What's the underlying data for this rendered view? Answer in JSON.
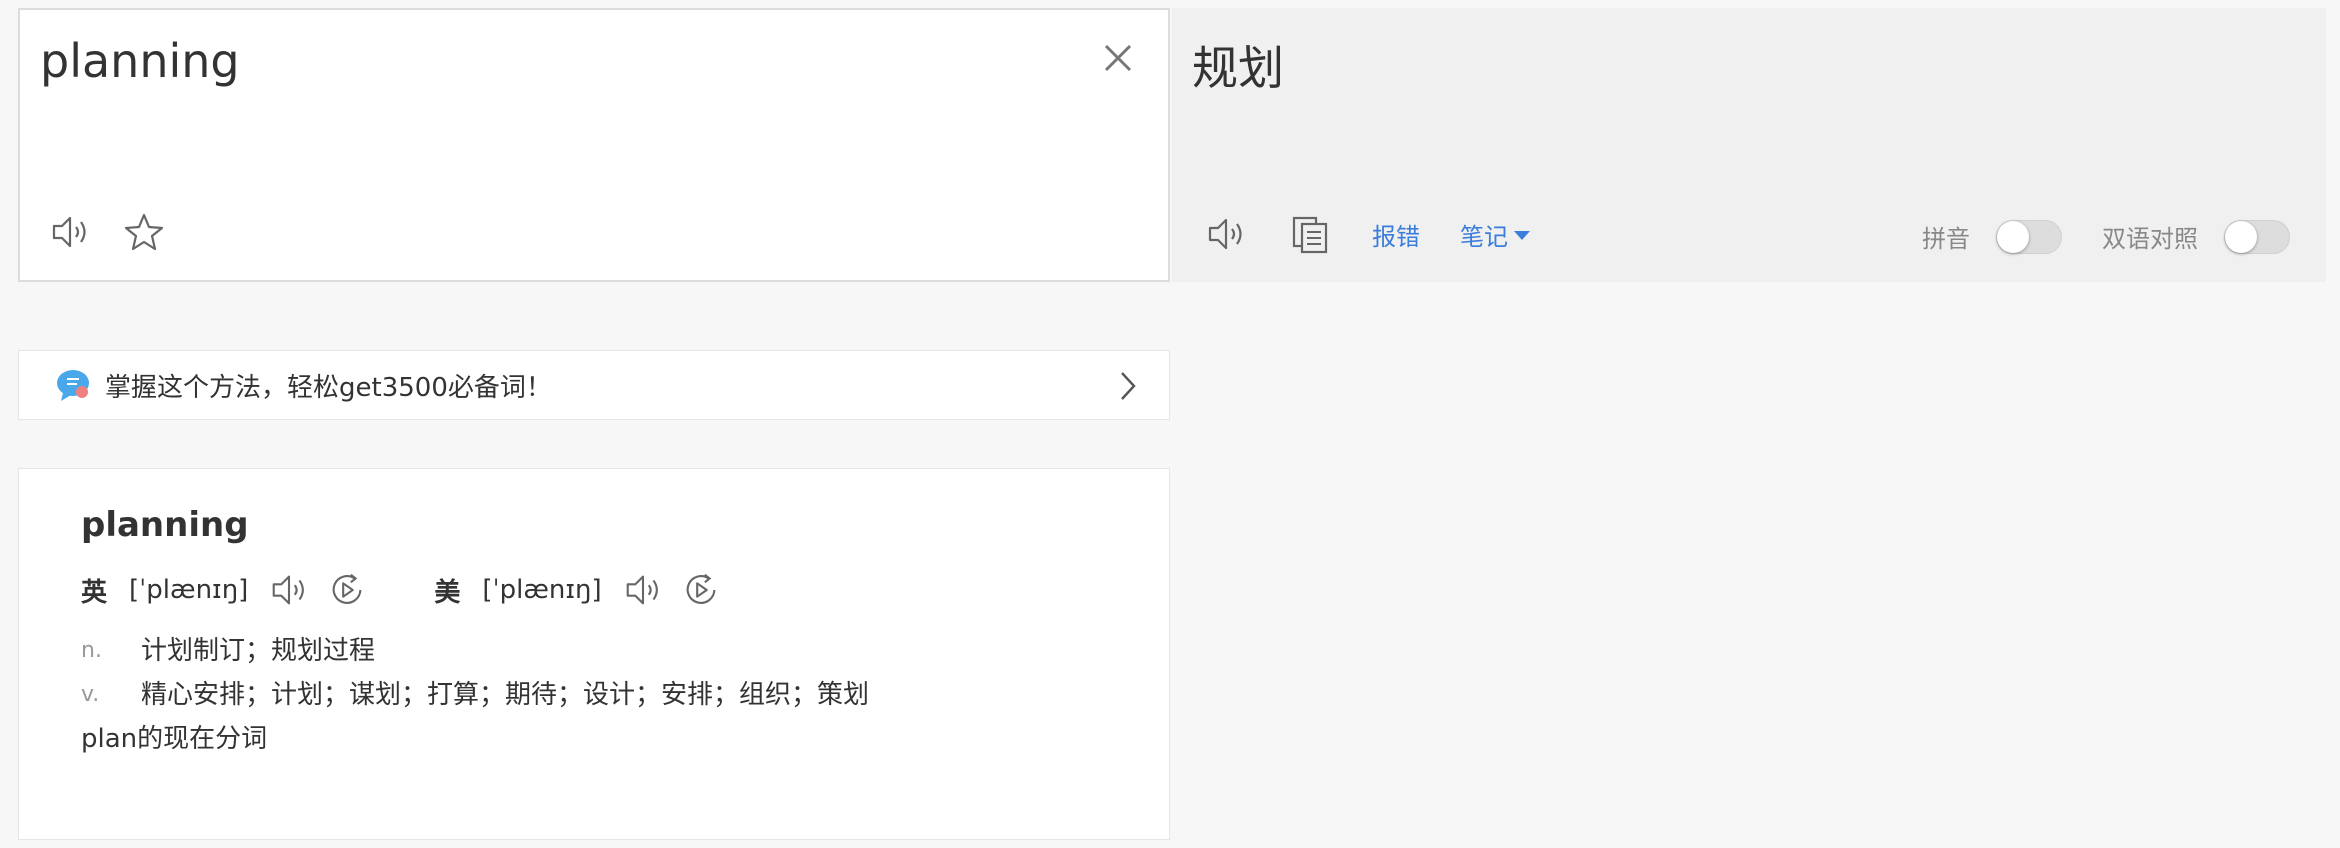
{
  "source": {
    "text": "planning",
    "icons": {
      "clear": "close-icon",
      "speak": "speaker-icon",
      "favorite": "star-icon"
    }
  },
  "target": {
    "text": "规划",
    "icons": {
      "speak": "speaker-icon",
      "copy": "copy-icon"
    },
    "report_label": "报错",
    "notes_label": "笔记",
    "pinyin_label": "拼音",
    "bilingual_label": "双语对照",
    "pinyin_on": false,
    "bilingual_on": false
  },
  "banner": {
    "text": "掌握这个方法，轻松get3500必备词！"
  },
  "dictionary": {
    "word": "planning",
    "uk": {
      "tag": "英",
      "phonetic": "[ˈplænɪŋ]"
    },
    "us": {
      "tag": "美",
      "phonetic": "[ˈplænɪŋ]"
    },
    "definitions": [
      {
        "pos": "n.",
        "meaning": "计划制订；规划过程"
      },
      {
        "pos": "v.",
        "meaning": "精心安排；计划；谋划；打算；期待；设计；安排；组织；策划"
      }
    ],
    "note": "plan的现在分词"
  },
  "colors": {
    "accent": "#3b7ddc",
    "muted": "#888888"
  }
}
